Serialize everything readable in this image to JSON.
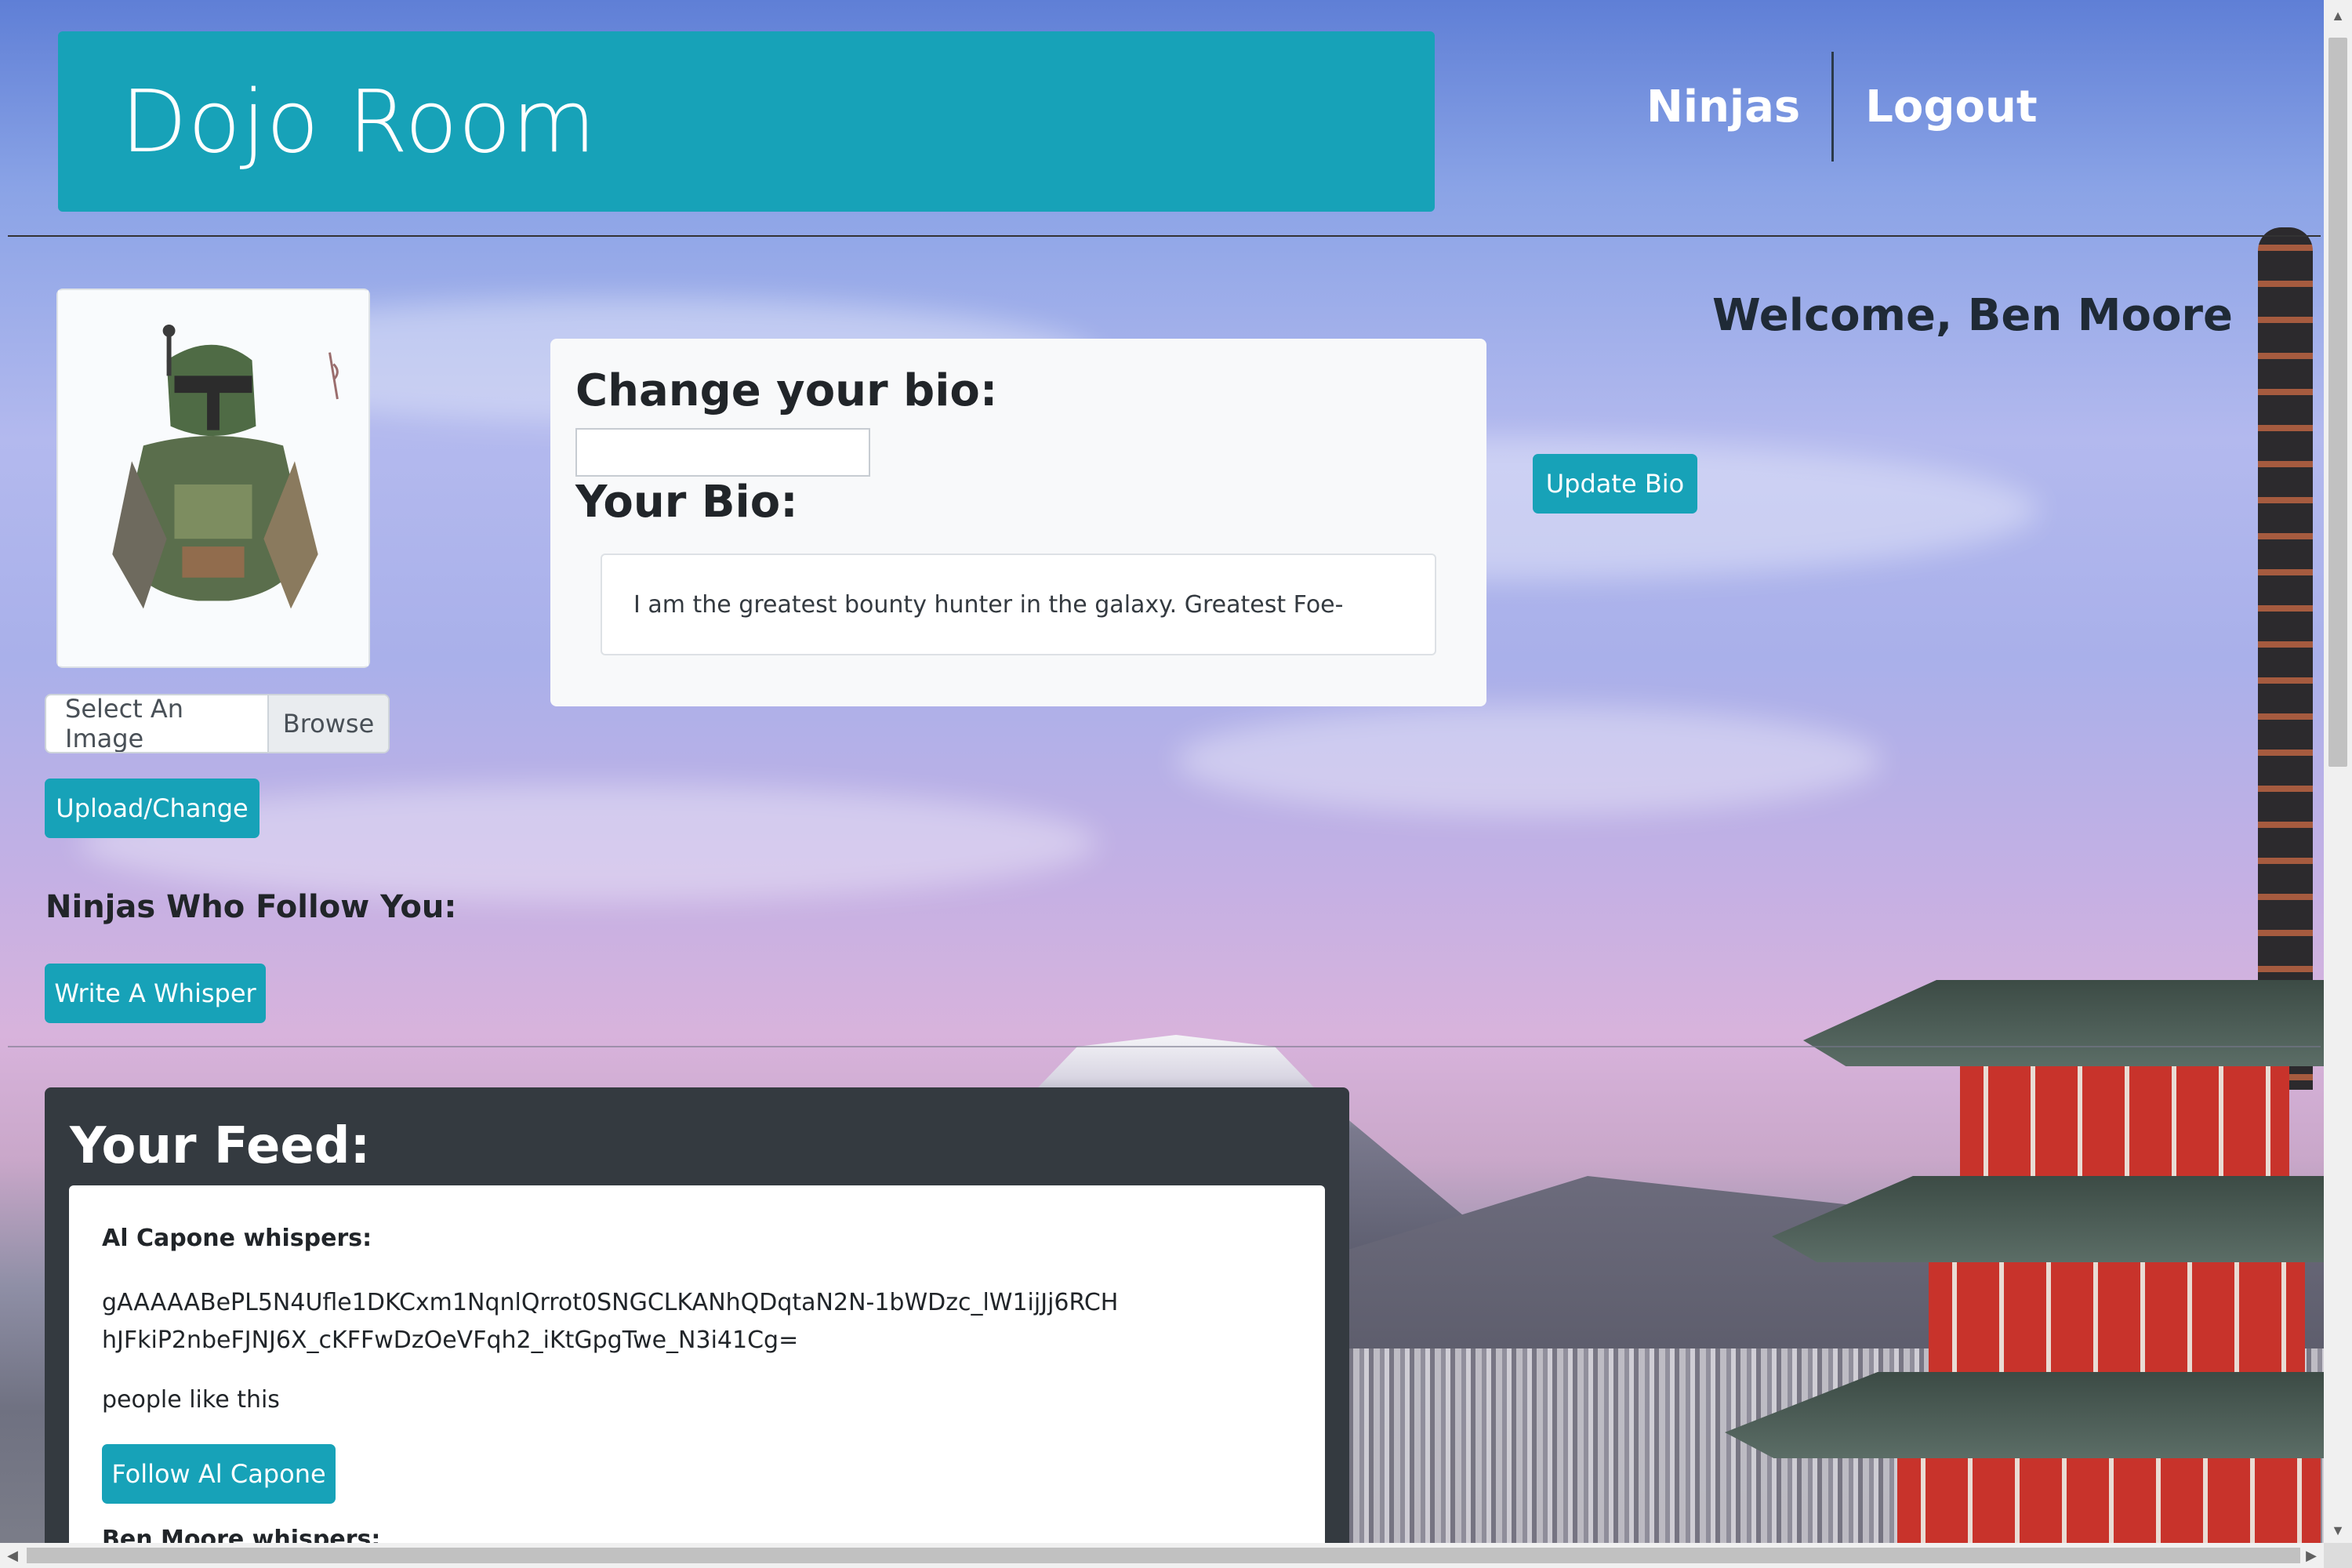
{
  "header": {
    "brand": "Dojo Room",
    "nav": [
      {
        "label": "Ninjas"
      },
      {
        "label": "Logout"
      }
    ]
  },
  "profile": {
    "avatar_icon": "bounty-hunter-portrait",
    "file_placeholder": "Select An Image",
    "browse_label": "Browse",
    "upload_label": "Upload/Change",
    "followers_title": "Ninjas Who Follow You:",
    "whisper_label": "Write A Whisper"
  },
  "bio": {
    "change_title": "Change your bio:",
    "input_value": "",
    "your_bio_title": "Your Bio:",
    "text": "I am the greatest bounty hunter in the galaxy. Greatest Foe-",
    "update_label": "Update Bio"
  },
  "welcome": "Welcome, Ben Moore",
  "feed": {
    "title": "Your Feed:",
    "posts": [
      {
        "author_line": "Al Capone whispers:",
        "message": "gAAAAABePL5N4Ufle1DKCxm1NqnlQrrot0SNGCLKANhQDqtaN2N-1bWDzc_lW1ijJj6RCHhJFkiP2nbeFJNJ6X_cKFFwDzOeVFqh2_iKtGpgTwe_N3i41Cg=",
        "likes": "people like this",
        "follow_label": "Follow Al Capone"
      }
    ],
    "next_author_partial": "Ben Moore whispers:"
  },
  "colors": {
    "accent": "#17a2b8",
    "feed_bg": "#343a40",
    "card_bg": "#f8f9fa"
  }
}
